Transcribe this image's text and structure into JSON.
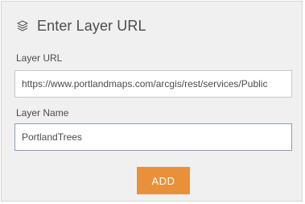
{
  "header": {
    "icon": "layers-icon",
    "title": "Enter Layer URL"
  },
  "layer_url": {
    "label": "Layer URL",
    "value": "https://www.portlandmaps.com/arcgis/rest/services/Public"
  },
  "layer_name": {
    "label": "Layer Name",
    "value": "PortlandTrees"
  },
  "add_button": {
    "label": "ADD"
  },
  "colors": {
    "accent": "#e8913a",
    "panel_background": "#f0f0f0",
    "text": "#4c4c4c"
  }
}
